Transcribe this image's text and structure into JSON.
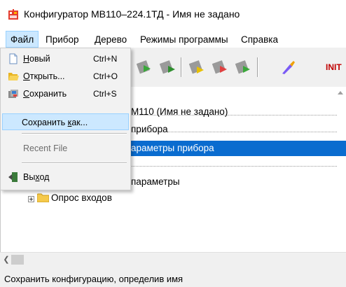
{
  "window": {
    "title": "Конфигуратор МВ110–224.1ТД - Имя не задано"
  },
  "menubar": {
    "items": [
      "Файл",
      "Прибор",
      "Дерево",
      "Режимы программы",
      "Справка"
    ]
  },
  "toolbar": {
    "icons": [
      "new-doc-icon",
      "open-folder-icon",
      "save-icon",
      "device-read-icon",
      "device-write-icon",
      "device-config-icon",
      "device-check-icon",
      "device-update-icon",
      "brush-icon"
    ],
    "init_label": "INIT"
  },
  "tree": {
    "nodes": {
      "root": "М110 (Имя не задано)",
      "device": "прибора",
      "params": "араметры прибора",
      "net_params": "параметры",
      "inputs": "Опрос входов"
    }
  },
  "file_menu": {
    "new": {
      "label_ul": "Н",
      "label_rest": "овый",
      "shortcut": "Ctrl+N"
    },
    "open": {
      "label_ul": "О",
      "label_rest": "ткрыть...",
      "shortcut": "Ctrl+O"
    },
    "save": {
      "label_ul": "С",
      "label_rest": "охранить",
      "shortcut": "Ctrl+S"
    },
    "save_as": {
      "label_pre": "Сохранить ",
      "label_ul": "к",
      "label_rest": "ак..."
    },
    "recent": {
      "label": "Recent File"
    },
    "exit": {
      "label_pre": "Вы",
      "label_ul": "х",
      "label_rest": "од"
    }
  },
  "statusbar": {
    "text": "Сохранить конфигурацию, определив имя"
  },
  "colors": {
    "selection": "#0a6ccf",
    "menu_highlight": "#cce8ff",
    "init_text": "#c00000"
  }
}
